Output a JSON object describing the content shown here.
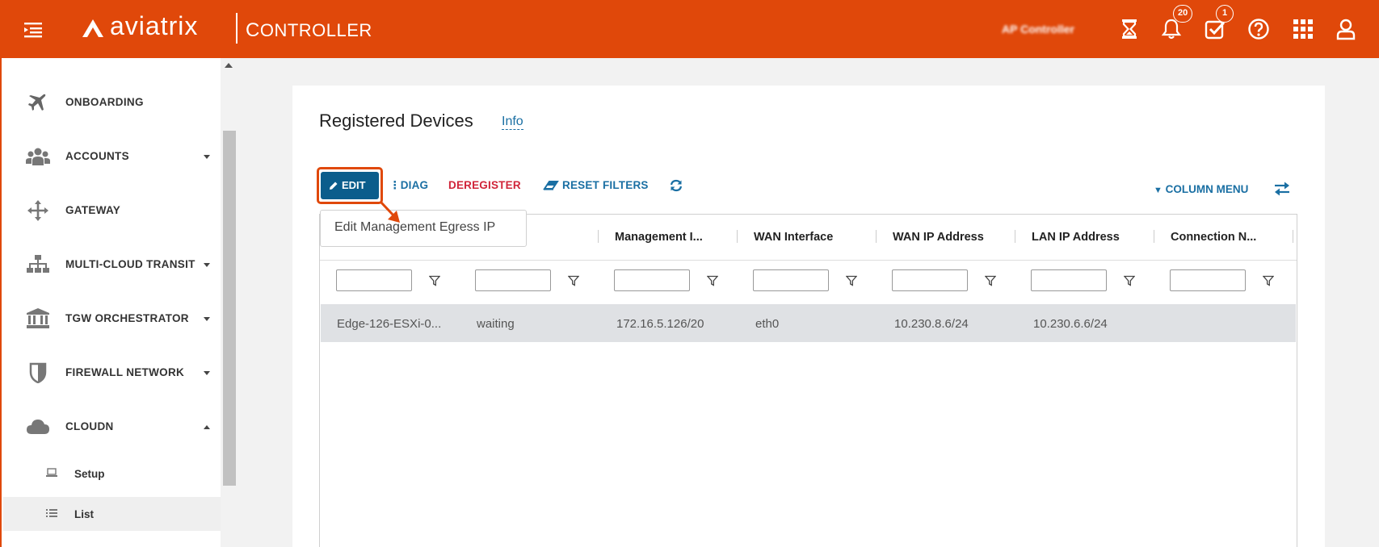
{
  "header": {
    "brand": "aviatrix",
    "product_first": "C",
    "product_rest": "ONTROLLER",
    "account": "AP Controller",
    "notifications_badge": "20",
    "tasks_badge": "1",
    "icons": [
      "menu-icon",
      "hourglass-icon",
      "bell-icon",
      "tasks-check-icon",
      "help-icon",
      "apps-grid-icon",
      "user-icon"
    ]
  },
  "sidebar": {
    "items": [
      {
        "label": "ONBOARDING",
        "icon": "plane-icon",
        "expandable": false
      },
      {
        "label": "ACCOUNTS",
        "icon": "users-icon",
        "expandable": true
      },
      {
        "label": "GATEWAY",
        "icon": "move-arrows-icon",
        "expandable": false
      },
      {
        "label": "MULTI-CLOUD TRANSIT",
        "icon": "sitemap-icon",
        "expandable": true
      },
      {
        "label": "TGW ORCHESTRATOR",
        "icon": "bank-icon",
        "expandable": true
      },
      {
        "label": "FIREWALL NETWORK",
        "icon": "shield-icon",
        "expandable": true
      },
      {
        "label": "CLOUDN",
        "icon": "cloud-icon",
        "expandable": true,
        "expanded": true
      }
    ],
    "sub_items": [
      {
        "label": "Setup",
        "icon": "laptop-icon"
      },
      {
        "label": "List",
        "icon": "list-icon",
        "active": true
      }
    ]
  },
  "main": {
    "title": "Registered Devices",
    "info": "Info",
    "toolbar": {
      "edit": "EDIT",
      "diag": "DIAG",
      "deregister": "DEREGISTER",
      "reset_filters": "RESET FILTERS",
      "column_menu": "COLUMN MENU"
    },
    "tooltip": "Edit Management Egress IP",
    "columns": [
      "Management I...",
      "WAN Interface",
      "WAN IP Address",
      "LAN IP Address",
      "Connection N..."
    ],
    "rows": [
      [
        "Edge-126-ESXi-0...",
        "waiting",
        "172.16.5.126/20",
        "eth0",
        "10.230.8.6/24",
        "10.230.6.6/24",
        ""
      ]
    ]
  },
  "colors": {
    "brand_orange": "#e0480a",
    "primary_blue": "#0b5d8c",
    "link_blue": "#1a6fa3",
    "danger_red": "#d0253a"
  }
}
